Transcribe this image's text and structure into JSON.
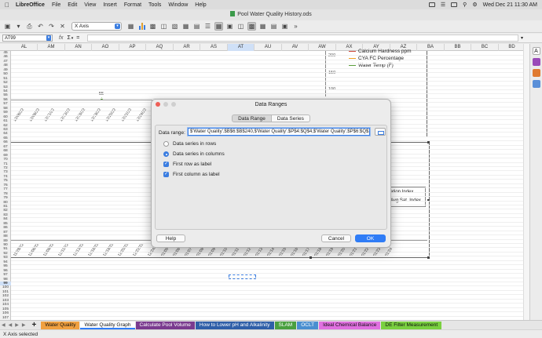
{
  "menubar": {
    "app_name": "LibreOffice",
    "items": [
      "File",
      "Edit",
      "View",
      "Insert",
      "Format",
      "Tools",
      "Window",
      "Help"
    ],
    "clock": "Wed Dec 21  11:30 AM"
  },
  "window": {
    "title": "Pool Water Quality History.ods"
  },
  "toolbar": {
    "element_select": "X Axis"
  },
  "formula_bar": {
    "name_box": "AT99",
    "fx": "fx",
    "sum": "Σ",
    "eq": "="
  },
  "columns": [
    "AL",
    "AM",
    "AN",
    "AO",
    "AP",
    "AQ",
    "AR",
    "AS",
    "AT",
    "AU",
    "AV",
    "AW",
    "AX",
    "AY",
    "AZ",
    "BA",
    "BB",
    "BC",
    "BD"
  ],
  "active_column": "AT",
  "rows": {
    "first": 45,
    "last": 107,
    "active": 99
  },
  "chart1": {
    "y_ticks": [
      "200",
      "150",
      "100"
    ],
    "data_label": "55",
    "legend": [
      {
        "label": "Calcium Hardness ppm",
        "color": "#d04a3c"
      },
      {
        "label": "CYA FC Percentage",
        "color": "#f0a020"
      },
      {
        "label": "Water Temp (F)",
        "color": "#5a9e3a"
      }
    ],
    "x_labels": [
      "12/06/22",
      "12/08/22",
      "12/11/22",
      "12/13/22",
      "12/16/22",
      "12/18/22",
      "12/20/22",
      "12/22/22",
      "12/24/22"
    ]
  },
  "chart2": {
    "legend": [
      "ation Index",
      "Avg Sat. Index"
    ],
    "x_labels": [
      "11/28/22",
      "12/06/22",
      "12/08/22",
      "12/11/22",
      "12/13/22",
      "12/16/22",
      "12/18/22",
      "12/20/22",
      "12/22/22",
      "12/24/22"
    ],
    "x_labels_right": [
      "01/05",
      "01/06",
      "01/07",
      "01/08",
      "01/09",
      "01/10",
      "01/11",
      "01/12",
      "01/13",
      "01/14",
      "01/15",
      "01/16",
      "01/17",
      "01/18",
      "01/19",
      "01/20",
      "01/21",
      "01/22",
      "01/23",
      "01/24"
    ]
  },
  "dialog": {
    "title": "Data Ranges",
    "tabs": [
      "Data Range",
      "Data Series"
    ],
    "active_tab": "Data Range",
    "data_range_label": "Data range:",
    "data_range_value": "$'Water Quality'.$B$6:$B$240,$'Water Quality'.$P$4:$Q$4,$'Water Quality'.$P$6:$Q$240",
    "opt_rows": "Data series in rows",
    "opt_columns": "Data series in columns",
    "first_row": "First row as label",
    "first_col": "First column as label",
    "help": "Help",
    "cancel": "Cancel",
    "ok": "OK"
  },
  "sheet_tabs": [
    {
      "label": "Water Quality",
      "color": "#f0a040",
      "active": false
    },
    {
      "label": "Water Quality Graph",
      "color": "#ffffff",
      "active": true
    },
    {
      "label": "Calculate Pool Volume",
      "color": "#7a3b8f",
      "active": false
    },
    {
      "label": "How to Lower pH and Alkalinity",
      "color": "#2f5fa8",
      "active": false
    },
    {
      "label": "SLAM",
      "color": "#4aa040",
      "active": false
    },
    {
      "label": "OCLT",
      "color": "#4a8fd0",
      "active": false
    },
    {
      "label": "Ideal Chemical Balance",
      "color": "#e070e0",
      "active": false
    },
    {
      "label": "DE Filter Measurement",
      "color": "#7ad040",
      "active": false
    }
  ],
  "status": "X Axis selected"
}
